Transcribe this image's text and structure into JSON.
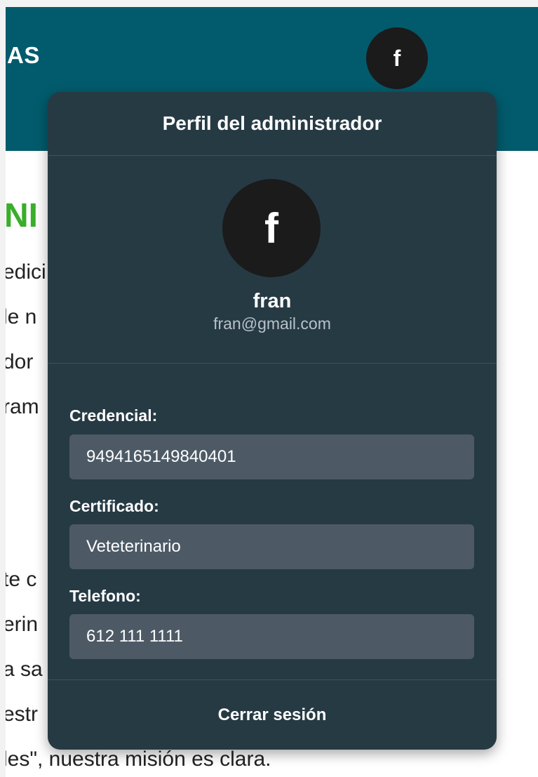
{
  "header": {
    "brand_fragment": "AS",
    "avatar_initial": "f"
  },
  "background": {
    "hero_title_fragment": "NI",
    "paragraph_1_lines": [
      "edici",
      "le n",
      "dor",
      "ram"
    ],
    "paragraph_2_lines": [
      "te c",
      "erin",
      "a sa",
      "estr",
      "les\", nuestra misión es clara."
    ]
  },
  "profile": {
    "title": "Perfil del administrador",
    "avatar_initial": "f",
    "name": "fran",
    "email": "fran@gmail.com",
    "fields": [
      {
        "label": "Credencial:",
        "value": "9494165149840401"
      },
      {
        "label": "Certificado:",
        "value": "Veteterinario"
      },
      {
        "label": "Telefono:",
        "value": "612 111 1111"
      }
    ],
    "logout_label": "Cerrar sesión"
  },
  "colors": {
    "header_bg": "#025b6c",
    "popover_bg": "#263a44",
    "field_bg": "#4d5a66",
    "hero_green": "#3aae2a"
  }
}
